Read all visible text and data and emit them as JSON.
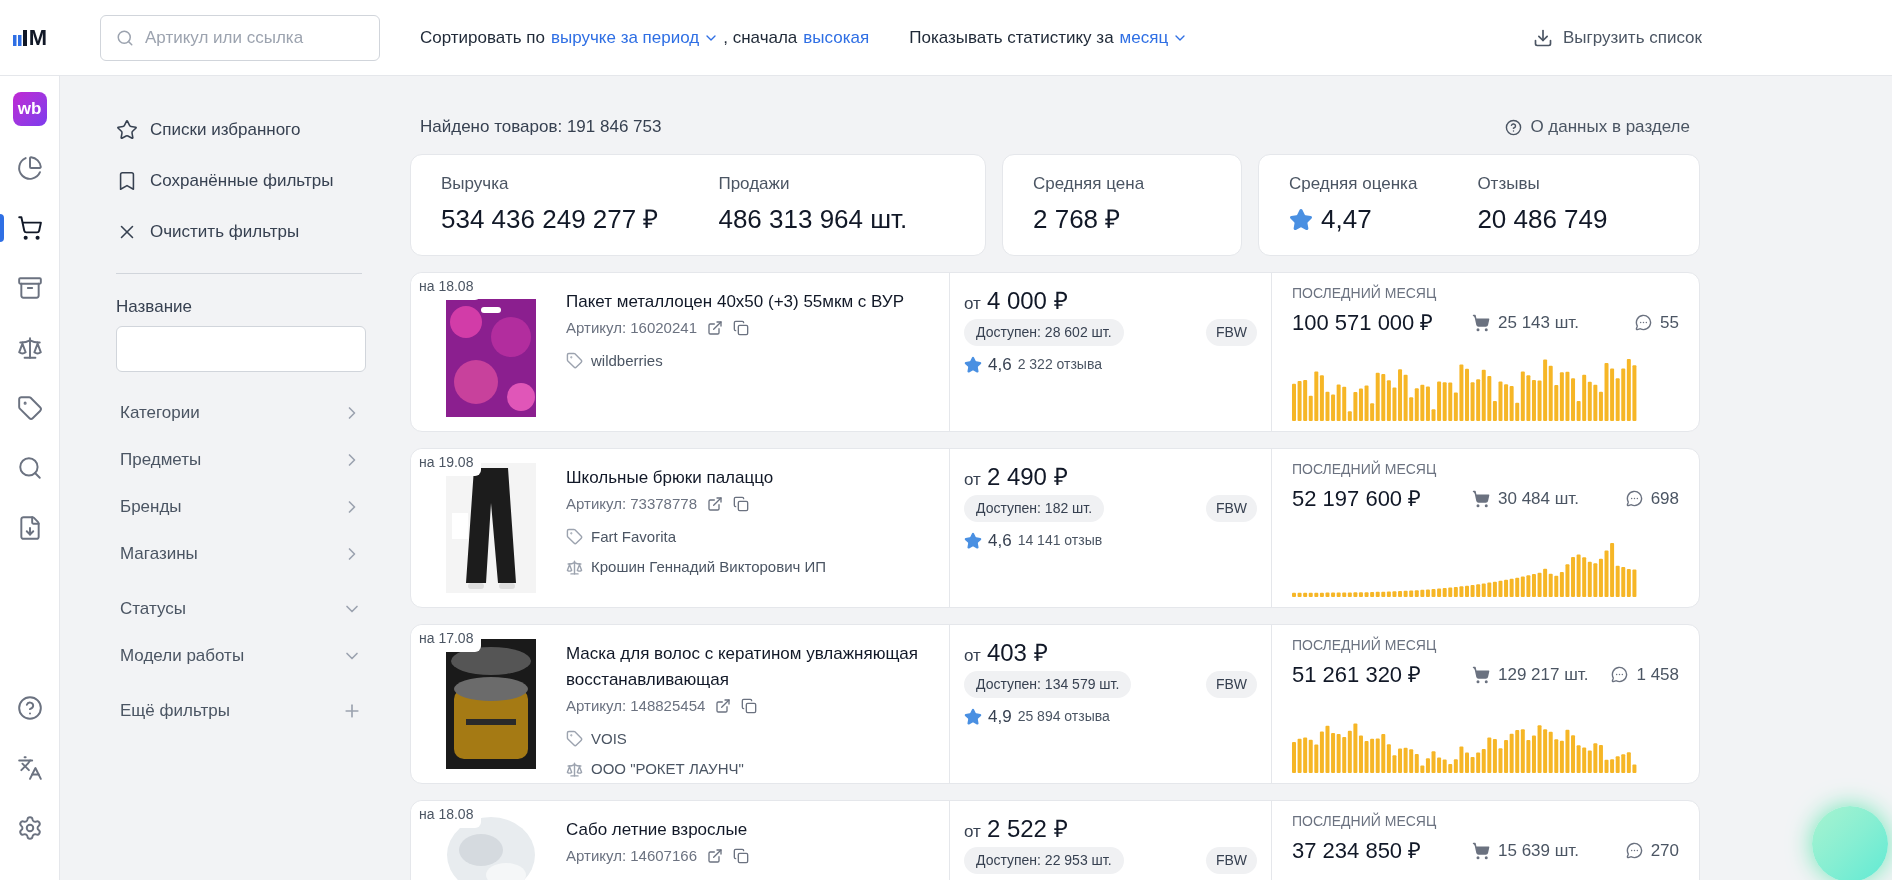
{
  "header": {
    "logo": "M",
    "search": {
      "placeholder": "Артикул или ссылка"
    },
    "sort": {
      "prefix": "Сортировать по",
      "field": "выручке за период",
      "separator": ", сначала",
      "order": "высокая"
    },
    "period": {
      "prefix": "Показывать статистику за",
      "value": "месяц"
    },
    "export": "Выгрузить список"
  },
  "rail": {
    "badge": "wb",
    "items": [
      {
        "selected": false
      },
      {
        "selected": true
      },
      {
        "selected": false
      },
      {
        "selected": false
      },
      {
        "selected": false
      },
      {
        "selected": false
      },
      {
        "selected": false
      }
    ],
    "bottom": [
      {
        "selected": false
      },
      {
        "selected": false
      },
      {
        "selected": false
      }
    ]
  },
  "filters": {
    "actions": [
      {
        "label": "Списки избранного"
      },
      {
        "label": "Сохранённые фильтры"
      },
      {
        "label": "Очистить фильтры"
      }
    ],
    "name_field": {
      "label": "Название"
    },
    "groups": [
      {
        "label": "Категории",
        "kind": "submenu"
      },
      {
        "label": "Предметы",
        "kind": "submenu"
      },
      {
        "label": "Бренды",
        "kind": "submenu"
      },
      {
        "label": "Магазины",
        "kind": "submenu"
      },
      {
        "label": "Статусы",
        "kind": "collapsible"
      },
      {
        "label": "Модели работы",
        "kind": "collapsible"
      },
      {
        "label": "Ещё фильтры",
        "kind": "add"
      }
    ]
  },
  "found": "Найдено товаров: 191 846 753",
  "about": "О данных в разделе",
  "summary": [
    {
      "metrics": [
        {
          "label": "Выручка",
          "value": "534 436 249 277 ₽"
        },
        {
          "label": "Продажи",
          "value": "486 313 964 шт."
        }
      ]
    },
    {
      "metrics": [
        {
          "label": "Средняя цена",
          "value": "2 768 ₽"
        }
      ]
    },
    {
      "metrics": [
        {
          "label": "Средняя оценка",
          "value": "4,47",
          "star": true
        },
        {
          "label": "Отзывы",
          "value": "20 486 749"
        }
      ]
    }
  ],
  "products": [
    {
      "date": "на 18.08",
      "title": "Пакет металлоцен 40x50 (+3) 55мкм с ВУР",
      "article": "Артикул: 16020241",
      "brand": "wildberries",
      "price_prefix": "от",
      "price": "4 000 ₽",
      "stock": "Доступен: 28 602 шт.",
      "model": "FBW",
      "rating": "4,6",
      "reviews": "2 322 отзыва",
      "period": "ПОСЛЕДНИЙ МЕСЯЦ",
      "revenue": "100 571 000 ₽",
      "sales": "25 143 шт.",
      "comments": "55"
    },
    {
      "date": "на 19.08",
      "title": "Школьные брюки палаццо",
      "article": "Артикул: 73378778",
      "brand": "Fart Favorita",
      "seller": "Крошин Геннадий Викторович ИП",
      "price_prefix": "от",
      "price": "2 490 ₽",
      "stock": "Доступен: 182 шт.",
      "model": "FBW",
      "rating": "4,6",
      "reviews": "14 141 отзыв",
      "period": "ПОСЛЕДНИЙ МЕСЯЦ",
      "revenue": "52 197 600 ₽",
      "sales": "30 484 шт.",
      "comments": "698"
    },
    {
      "date": "на 17.08",
      "title": "Маска для волос с кератином увлажняющая восстанавливающая",
      "article": "Артикул: 148825454",
      "brand": "VOIS",
      "seller": "ООО \"РОКЕТ ЛАУНЧ\"",
      "price_prefix": "от",
      "price": "403 ₽",
      "stock": "Доступен: 134 579 шт.",
      "model": "FBW",
      "rating": "4,9",
      "reviews": "25 894 отзыва",
      "period": "ПОСЛЕДНИЙ МЕСЯЦ",
      "revenue": "51 261 320 ₽",
      "sales": "129 217 шт.",
      "comments": "1 458"
    },
    {
      "date": "на 18.08",
      "title": "Сабо летние взрослые",
      "article": "Артикул: 14607166",
      "price_prefix": "от",
      "price": "2 522 ₽",
      "stock": "Доступен: 22 953 шт.",
      "model": "FBW",
      "period": "ПОСЛЕДНИЙ МЕСЯЦ",
      "revenue": "37 234 850 ₽",
      "sales": "15 639 шт.",
      "comments": "270"
    }
  ]
}
